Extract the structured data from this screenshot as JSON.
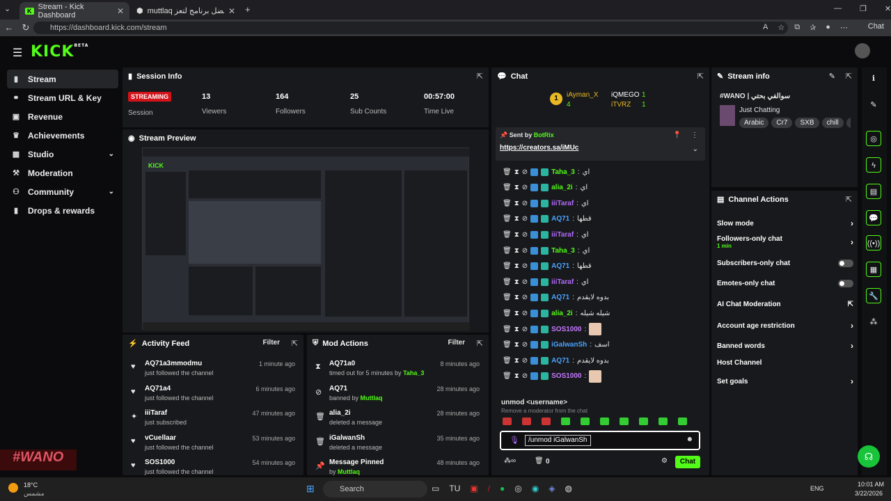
{
  "browser": {
    "tabs": [
      {
        "title": "Stream - Kick Dashboard"
      },
      {
        "title": "muttlaq تصنيف | أفضل برنامج لتعز"
      }
    ],
    "url": "https://dashboard.kick.com/stream",
    "chat_button": "Chat"
  },
  "app": {
    "logo": "KICK",
    "logo_sup": "BETA",
    "sidebar": [
      {
        "label": "Stream",
        "icon": "stream-icon",
        "active": true
      },
      {
        "label": "Stream URL & Key",
        "icon": "link-icon"
      },
      {
        "label": "Revenue",
        "icon": "revenue-icon"
      },
      {
        "label": "Achievements",
        "icon": "trophy-icon"
      },
      {
        "label": "Studio",
        "icon": "studio-icon",
        "chevron": true
      },
      {
        "label": "Moderation",
        "icon": "hammer-icon"
      },
      {
        "label": "Community",
        "icon": "community-icon",
        "chevron": true
      },
      {
        "label": "Drops & rewards",
        "icon": "chart-icon"
      }
    ]
  },
  "session": {
    "title": "Session Info",
    "status": "STREAMING",
    "status_label": "Session",
    "stats": [
      {
        "value": "13",
        "label": "Viewers"
      },
      {
        "value": "164",
        "label": "Followers"
      },
      {
        "value": "25",
        "label": "Sub Counts"
      },
      {
        "value": "00:57:00",
        "label": "Time Live"
      }
    ]
  },
  "preview": {
    "title": "Stream Preview"
  },
  "activity": {
    "title": "Activity Feed",
    "filter": "Filter",
    "items": [
      {
        "name": "AQ71a3mmodmu",
        "sub": "just followed the channel",
        "time": "1 minute ago",
        "icon": "heart-icon"
      },
      {
        "name": "AQ71a4",
        "sub": "just followed the channel",
        "time": "6 minutes ago",
        "icon": "heart-icon"
      },
      {
        "name": "iiiTaraf",
        "sub": "just subscribed",
        "time": "47 minutes ago",
        "icon": "star-icon"
      },
      {
        "name": "vCuellaar",
        "sub": "just followed the channel",
        "time": "53 minutes ago",
        "icon": "heart-icon"
      },
      {
        "name": "SOS1000",
        "sub": "just followed the channel",
        "time": "54 minutes ago",
        "icon": "heart-icon"
      }
    ]
  },
  "mod": {
    "title": "Mod Actions",
    "filter": "Filter",
    "items": [
      {
        "name": "AQ71a0",
        "sub": "timed out for 5 minutes by ",
        "by": "Taha_3",
        "time": "8 minutes ago",
        "icon": "hourglass-icon"
      },
      {
        "name": "AQ71",
        "sub": "banned by ",
        "by": "Muttlaq",
        "time": "28 minutes ago",
        "icon": "ban-icon"
      },
      {
        "name": "alia_2i",
        "sub": "deleted a message",
        "by": "",
        "time": "28 minutes ago",
        "icon": "trash-icon"
      },
      {
        "name": "iGalwanSh",
        "sub": "deleted a message",
        "by": "",
        "time": "35 minutes ago",
        "icon": "trash-icon"
      },
      {
        "name": "Message Pinned",
        "sub": "by ",
        "by": "Muttlaq",
        "time": "48 minutes ago",
        "icon": "pin-icon"
      }
    ]
  },
  "chat": {
    "title": "Chat",
    "leader": {
      "rank": "1",
      "name": "iAyman_X",
      "count": "4"
    },
    "leaders2": [
      {
        "name": "iQMEGO",
        "count": "1"
      },
      {
        "name": "iTVRZ",
        "count": "1"
      }
    ],
    "pinned": {
      "sent_by": "Sent by",
      "author": "BotRix",
      "link": "https://creators.sa/iMUc"
    },
    "messages": [
      {
        "user": "Taha_3",
        "color": "#53fc18",
        "text": "اي"
      },
      {
        "user": "alia_2i",
        "color": "#53fc18",
        "text": "اي"
      },
      {
        "user": "iiiTaraf",
        "color": "#b36bff",
        "text": "اي"
      },
      {
        "user": "AQ71",
        "color": "#4aa3ff",
        "text": "قطها"
      },
      {
        "user": "iiiTaraf",
        "color": "#b36bff",
        "text": "اي"
      },
      {
        "user": "Taha_3",
        "color": "#53fc18",
        "text": "اي"
      },
      {
        "user": "AQ71",
        "color": "#4aa3ff",
        "text": "قطها"
      },
      {
        "user": "iiiTaraf",
        "color": "#b36bff",
        "text": "اي"
      },
      {
        "user": "AQ71",
        "color": "#4aa3ff",
        "text": "بدوه لايقدم"
      },
      {
        "user": "alia_2i",
        "color": "#53fc18",
        "text": "شيله شيله"
      },
      {
        "user": "SOS1000",
        "color": "#c678ff",
        "text": ""
      },
      {
        "user": "iGalwanSh",
        "color": "#4aa3ff",
        "text": "اسف"
      },
      {
        "user": "AQ71",
        "color": "#4aa3ff",
        "text": "بدوه لايقدم"
      },
      {
        "user": "SOS1000",
        "color": "#c678ff",
        "text": ""
      }
    ],
    "suggest_cmd": "unmod <username>",
    "suggest_desc": "Remove a moderator from the chat",
    "input_value": "/unmod iGalwanSh",
    "count": "0",
    "send": "Chat"
  },
  "stream_info": {
    "title": "Stream info",
    "stream_title": "#WANO | سوالفي بحتي",
    "category": "Just Chatting",
    "tags": [
      "Arabic",
      "Cr7",
      "SXB",
      "chill",
      "ga"
    ]
  },
  "channel_actions": {
    "title": "Channel Actions",
    "items": [
      {
        "label": "Slow mode",
        "type": "chevron"
      },
      {
        "label": "Followers-only chat",
        "sub": "1 min",
        "type": "chevron"
      },
      {
        "label": "Subscribers-only chat",
        "type": "toggle"
      },
      {
        "label": "Emotes-only chat",
        "type": "toggle"
      },
      {
        "label": "AI Chat Moderation",
        "type": "external"
      },
      {
        "label": "Account age restriction",
        "type": "chevron"
      },
      {
        "label": "Banned words",
        "type": "chevron"
      },
      {
        "label": "Host Channel",
        "type": "none"
      },
      {
        "label": "Set goals",
        "type": "chevron"
      }
    ]
  },
  "taskbar": {
    "weather": "18°C",
    "weather_sub": "مشمس",
    "search": "Search",
    "lang": "ENG",
    "time": "10:01 AM",
    "date": "3/22/2026"
  },
  "overlay": {
    "watermark": "#WANO"
  },
  "colors": {
    "accent": "#53fc18",
    "live": "#d3121a"
  }
}
